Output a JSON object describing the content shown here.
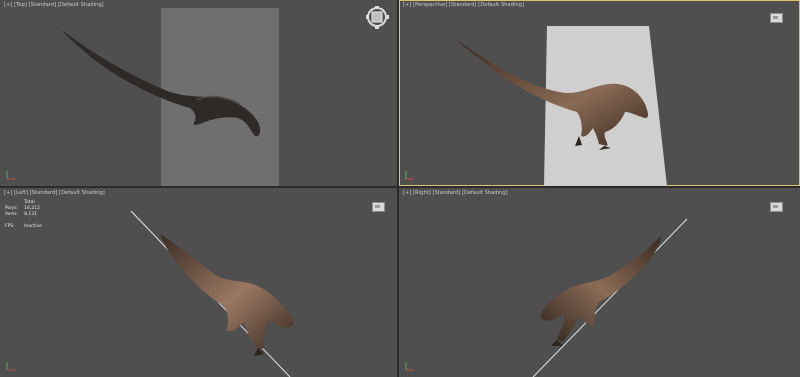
{
  "viewports": {
    "top_left": {
      "label": "[+] [Top] [Standard] [Default Shading]"
    },
    "top_right": {
      "label": "[+] [Perspective] [Standard] [Default Shading]"
    },
    "bottom_left": {
      "label": "[+] [Left] [Standard] [Default Shading]"
    },
    "bottom_right": {
      "label": "[+] [Right] [Standard] [Default Shading]"
    }
  },
  "stats": {
    "total_label": "Total",
    "polys_label": "Polys:",
    "polys_value": "16,212",
    "verts_label": "Verts:",
    "verts_value": "8,131",
    "fps_label": "FPS:",
    "fps_value": "Inactive"
  },
  "icons": [
    "viewcube-compass-icon",
    "viewcube-icon",
    "axis-gizmo-icon"
  ],
  "colors": {
    "viewport_bg": "#4f4f4f",
    "border": "#2b2b2b",
    "active_border": "#e0c26a",
    "plane_light": "#cccccc",
    "plane_dark": "#747474",
    "model_dark": "#3d2f27",
    "model_light": "#9b7a62"
  }
}
